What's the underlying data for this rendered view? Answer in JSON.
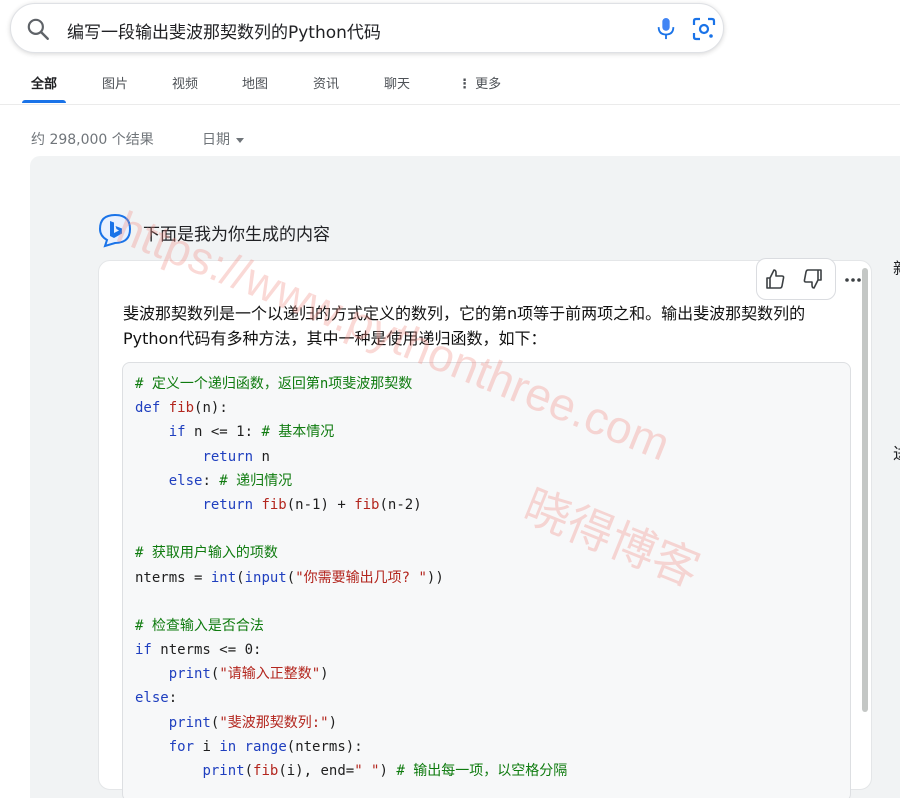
{
  "search": {
    "query": "编写一段输出斐波那契数列的Python代码",
    "icons": {
      "search": "search-icon",
      "mic": "mic-icon",
      "lens": "lens-icon"
    }
  },
  "tabs": [
    {
      "label": "全部",
      "active": true
    },
    {
      "label": "图片",
      "active": false
    },
    {
      "label": "视频",
      "active": false
    },
    {
      "label": "地图",
      "active": false
    },
    {
      "label": "资讯",
      "active": false
    },
    {
      "label": "聊天",
      "active": false
    },
    {
      "label": "更多",
      "active": false
    }
  ],
  "results": {
    "count_text": "约 298,000 个结果",
    "date_filter": "日期"
  },
  "ai_answer": {
    "heading": "下面是我为你生成的内容",
    "intro": "斐波那契数列是一个以递归的方式定义的数列，它的第n项等于前两项之和。输出斐波那契数列的Python代码有多种方法，其中一种是使用递归函数，如下：",
    "code_lines": [
      "# 定义一个递归函数，返回第n项斐波那契数",
      "def fib(n):",
      "    if n <= 1: # 基本情况",
      "        return n",
      "    else: # 递归情况",
      "        return fib(n-1) + fib(n-2)",
      "",
      "# 获取用户输入的项数",
      "nterms = int(input(\"你需要输出几项? \"))",
      "",
      "# 检查输入是否合法",
      "if nterms <= 0:",
      "    print(\"请输入正整数\")",
      "else:",
      "    print(\"斐波那契数列:\")",
      "    for i in range(nterms):",
      "        print(fib(i), end=\" \") # 输出每一项，以空格分隔"
    ]
  },
  "watermark": {
    "url": "https://www.pythonthree.com",
    "name": "晓得博客"
  },
  "side_chars": [
    "新",
    "进"
  ],
  "colors": {
    "accent": "#1a73e8",
    "panel_bg": "#f1f3f4",
    "comment": "#0f7b0f",
    "keyword": "#1f3fbf",
    "string": "#b3261e"
  }
}
